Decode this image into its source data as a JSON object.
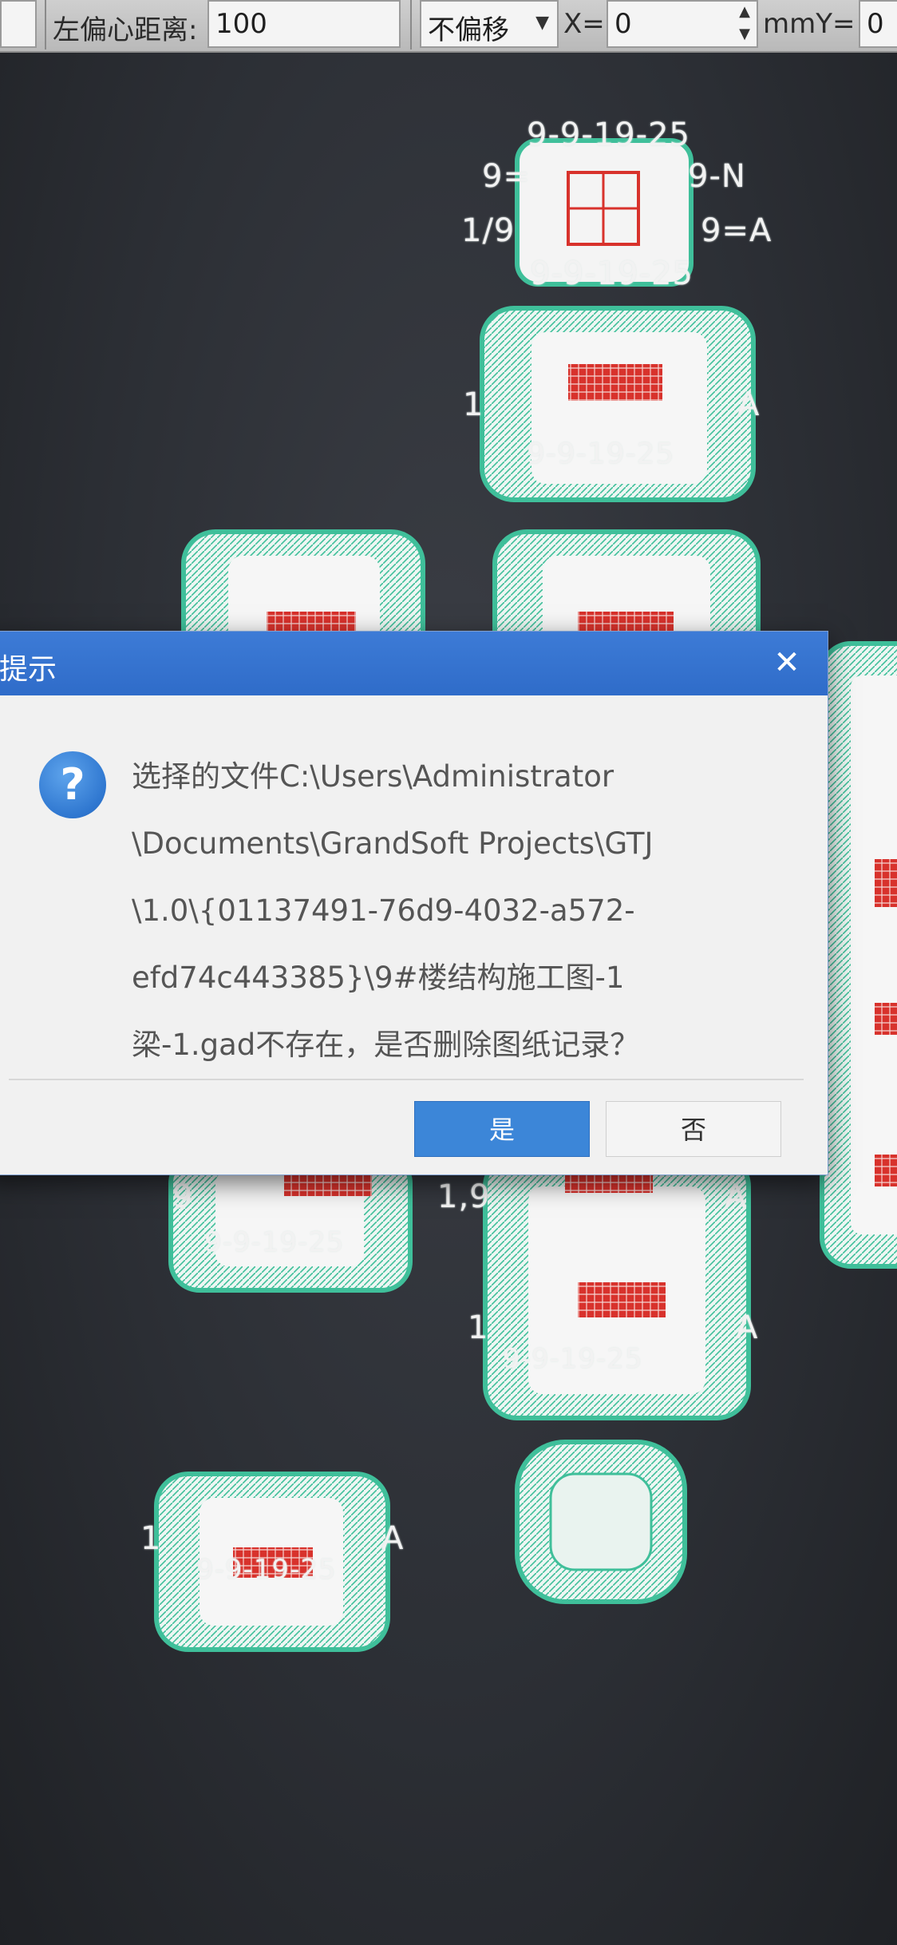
{
  "toolbar": {
    "left_offset_label": "左偏心距离:",
    "left_offset_value": "100",
    "offset_mode_value": "不偏移",
    "x_label": "X=",
    "x_value": "0",
    "y_label": "mmY=",
    "y_value": "0"
  },
  "canvas": {
    "labels": {
      "axis_9_19_25": "9-9-19-25",
      "axis_9_n": "9=",
      "axis_9_n_right": "9-N",
      "axis_1_9": "1/9",
      "axis_9_a": "9=A",
      "small_a": "A",
      "small_1": "1",
      "small_9": "9",
      "small_19": "1,9"
    },
    "colors": {
      "background": "#2c2f35",
      "rebar_green": "#3fbf9a",
      "section_fill": "#f4f4f4",
      "rebar_red": "#d8322c"
    }
  },
  "dialog": {
    "title": "提示",
    "close_glyph": "✕",
    "icon_glyph": "?",
    "message_lines": [
      "选择的文件C:\\Users\\Administrator",
      "\\Documents\\GrandSoft Projects\\GTJ",
      "\\1.0\\{01137491-76d9-4032-a572-",
      "efd74c443385}\\9#楼结构施工图-1",
      "梁-1.gad不存在，是否删除图纸记录？"
    ],
    "yes_label": "是",
    "no_label": "否"
  }
}
